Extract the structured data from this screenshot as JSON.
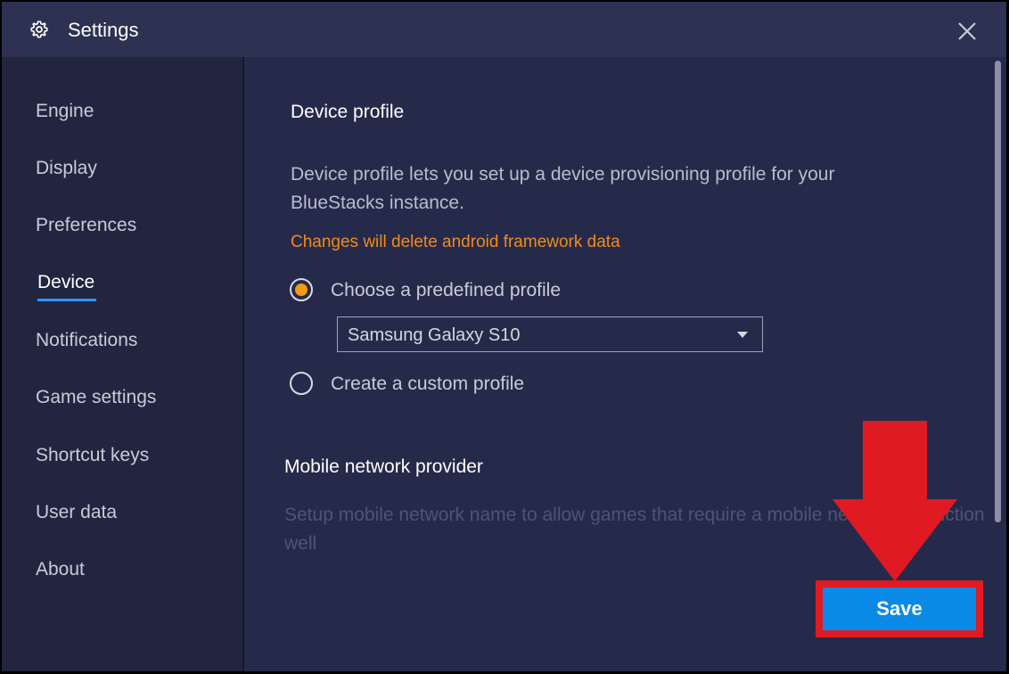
{
  "window": {
    "title": "Settings",
    "title_icon": "gear-icon",
    "close_icon": "close-icon"
  },
  "sidebar": {
    "items": [
      {
        "label": "Engine",
        "active": false
      },
      {
        "label": "Display",
        "active": false
      },
      {
        "label": "Preferences",
        "active": false
      },
      {
        "label": "Device",
        "active": true
      },
      {
        "label": "Notifications",
        "active": false
      },
      {
        "label": "Game settings",
        "active": false
      },
      {
        "label": "Shortcut keys",
        "active": false
      },
      {
        "label": "User data",
        "active": false
      },
      {
        "label": "About",
        "active": false
      }
    ]
  },
  "device_profile": {
    "heading": "Device profile",
    "description": "Device profile lets you set up a device provisioning profile for your BlueStacks instance.",
    "warning": "Changes will delete android framework data",
    "options": [
      {
        "label": "Choose a predefined profile",
        "selected": true
      },
      {
        "label": "Create a custom profile",
        "selected": false
      }
    ],
    "profile_select_value": "Samsung Galaxy S10"
  },
  "mobile_network": {
    "heading": "Mobile network provider",
    "description": "Setup mobile network name to allow games that require a mobile network to function well"
  },
  "footer": {
    "save_label": "Save"
  },
  "colors": {
    "accent": "#0a8ae6",
    "warning": "#f08b1b",
    "radio_selected": "#f39a13",
    "highlight": "#e01a22",
    "background": "#262a4a"
  }
}
